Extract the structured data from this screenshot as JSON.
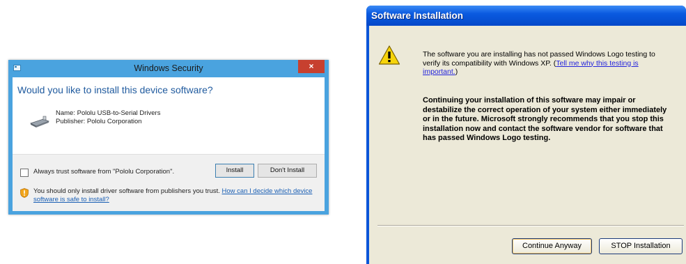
{
  "windows8_dialog": {
    "title": "Windows Security",
    "close_label": "×",
    "heading": "Would you like to install this device software?",
    "name_line": "Name: Pololu USB-to-Serial Drivers",
    "publisher_line": "Publisher: Pololu Corporation",
    "always_trust_label": "Always trust software from \"Pololu Corporation\".",
    "always_trust_checked": false,
    "install_label": "Install",
    "dont_install_label": "Don't Install",
    "notice_text": "You should only install driver software from publishers you trust. ",
    "notice_link": "How can I decide which device software is safe to install?",
    "accent_color": "#4aa3df"
  },
  "xp_dialog": {
    "title": "Software Installation",
    "message_text": "The software you are installing has not passed Windows Logo testing to verify its compatibility with Windows XP. (",
    "message_link": "Tell me why this testing is important.",
    "message_close": ")",
    "warning_text": "Continuing your installation of this software may impair or destabilize the correct operation of your system either immediately or in the future. Microsoft strongly recommends that you stop this installation now and contact the software vendor for software that has passed Windows Logo testing.",
    "continue_label": "Continue Anyway",
    "stop_label": "STOP Installation",
    "title_color": "#0a5ae0"
  }
}
